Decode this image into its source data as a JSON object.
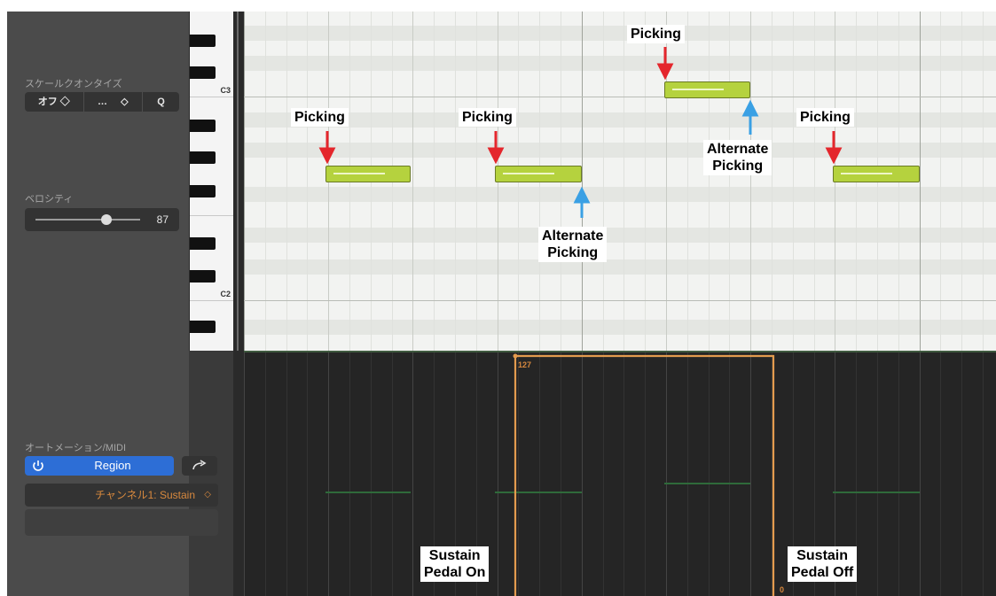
{
  "inspector": {
    "scale_quantize_label": "スケールクオンタイズ",
    "scale_quantize": {
      "off": "オフ",
      "arrows1": "◇",
      "dots": "…",
      "arrows2": "◇",
      "q": "Q"
    },
    "velocity_label": "ベロシティ",
    "velocity_value": "87",
    "velocity_level": 0.68,
    "automation_label": "オートメーション/MIDI",
    "region_button": "Region",
    "channel_select": "チャンネル1: Sustain",
    "channel_chevron": "◇"
  },
  "piano": {
    "c3": "C3",
    "c2": "C2"
  },
  "automation": {
    "value_on": "127",
    "value_off": "0"
  },
  "annotations": {
    "picking_1": "Picking",
    "picking_2": "Picking",
    "picking_3": "Picking",
    "picking_4": "Picking",
    "alternate_1_line1": "Alternate",
    "alternate_1_line2": "Picking",
    "alternate_2_line1": "Alternate",
    "alternate_2_line2": "Picking",
    "sustain_on_line1": "Sustain",
    "sustain_on_line2": "Pedal On",
    "sustain_off_line1": "Sustain",
    "sustain_off_line2": "Pedal Off"
  },
  "colors": {
    "note_green": "#b5d23e",
    "automation_orange": "#e39b4e",
    "arrow_red": "#e4262c",
    "arrow_blue": "#3aa0e4",
    "region_blue": "#2d6ed6"
  }
}
